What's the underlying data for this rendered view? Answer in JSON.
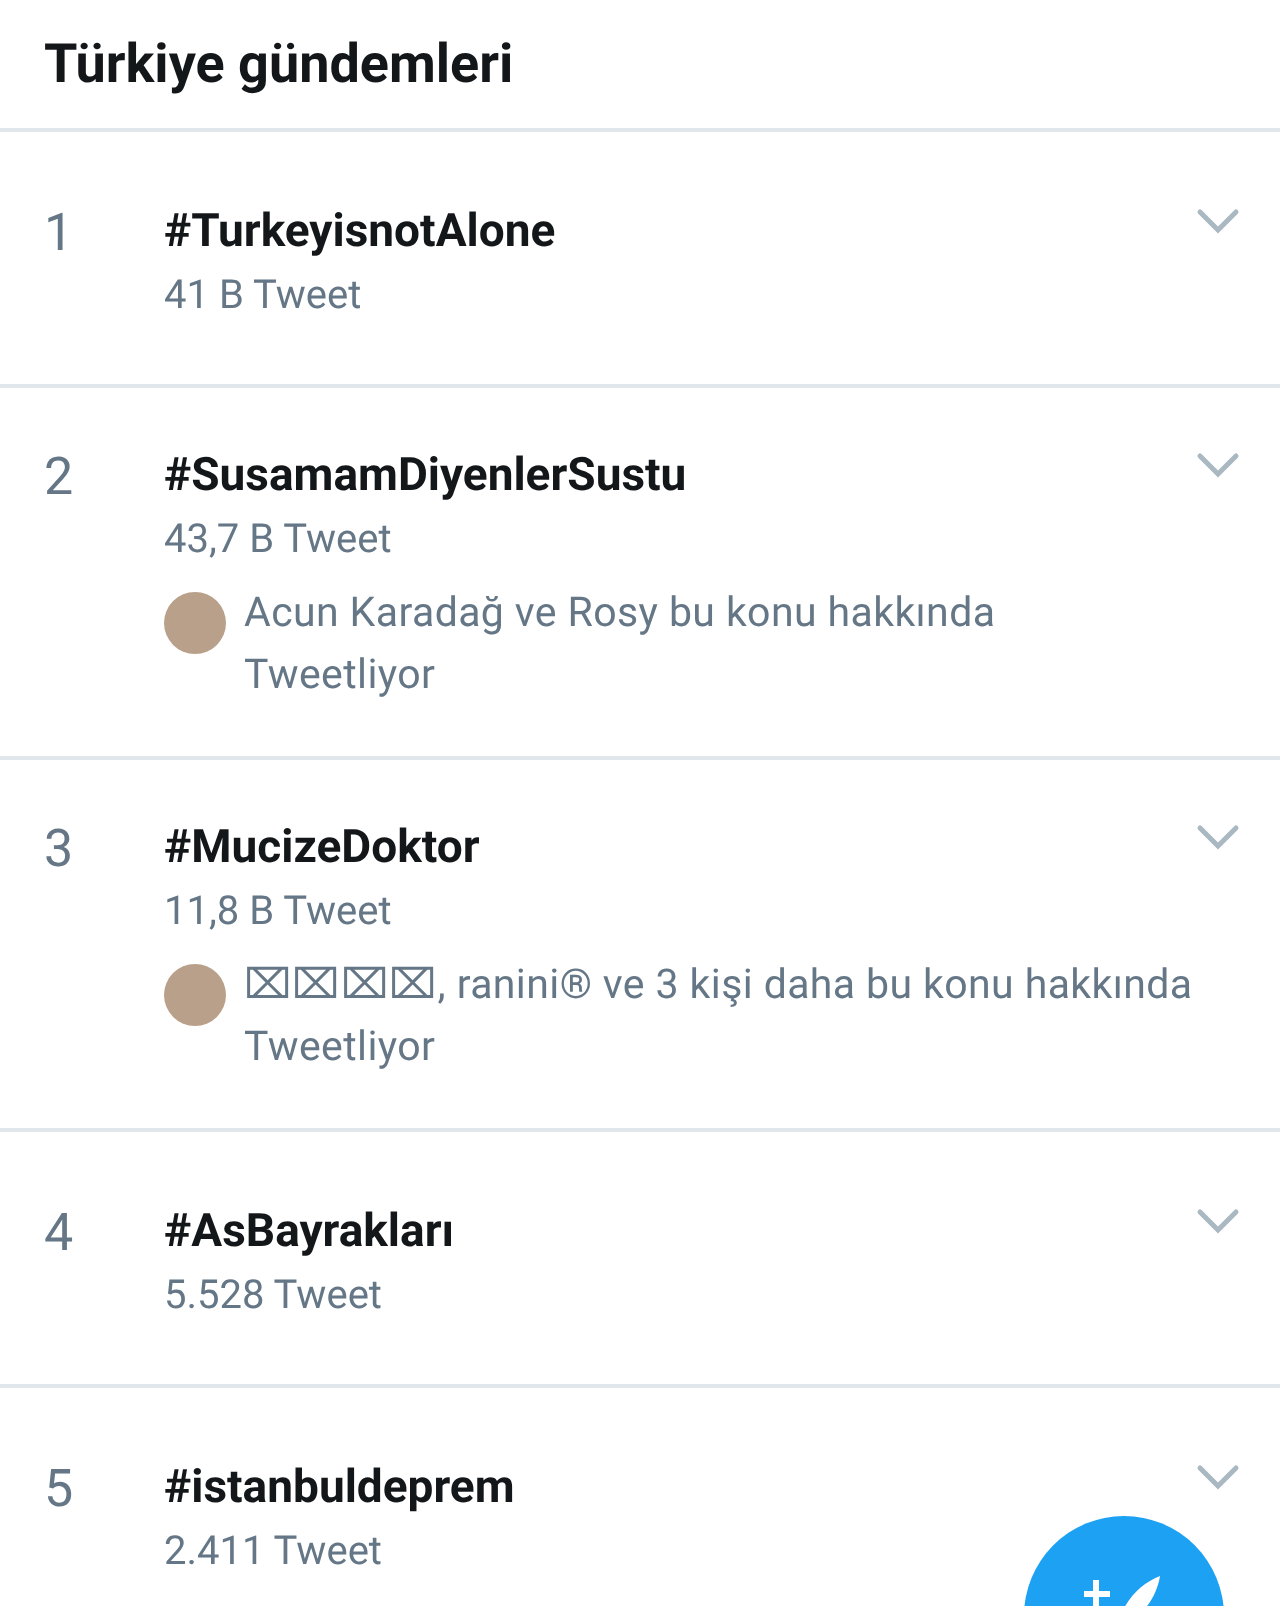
{
  "header": {
    "title": "Türkiye gündemleri"
  },
  "trends": [
    {
      "rank": "1",
      "hashtag": "#TurkeyisnotAlone",
      "count": "41 B Tweet"
    },
    {
      "rank": "2",
      "hashtag": "#SusamamDiyenlerSustu",
      "count": "43,7 B Tweet",
      "context": "Acun Karadağ ve Rosy bu konu hakkında Tweetliyor"
    },
    {
      "rank": "3",
      "hashtag": "#MucizeDoktor",
      "count": "11,8 B Tweet",
      "context": "⌧⌧⌧⌧, ranini® ve 3 kişi daha bu konu hakkında Tweetliyor"
    },
    {
      "rank": "4",
      "hashtag": "#AsBayrakları",
      "count": "5.528 Tweet"
    },
    {
      "rank": "5",
      "hashtag": "#istanbuldeprem",
      "count": "2.411 Tweet"
    }
  ]
}
